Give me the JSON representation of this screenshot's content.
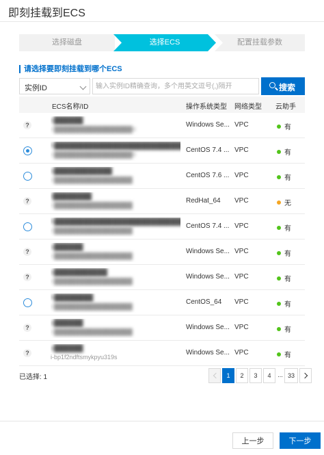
{
  "header": {
    "title": "即刻挂载到ECS"
  },
  "steps": [
    {
      "label": "选择磁盘",
      "state": "done"
    },
    {
      "label": "选择ECS",
      "state": "active"
    },
    {
      "label": "配置挂载参数",
      "state": "pending"
    }
  ],
  "section": {
    "label": "请选择要即刻挂载到哪个ECS"
  },
  "search": {
    "field_select_value": "实例ID",
    "placeholder": "输入实例ID精确查询，多个用英文逗号(,)隔开",
    "button_label": "搜索"
  },
  "table": {
    "columns": [
      "ECS名称/ID",
      "操作系统类型",
      "网络类型",
      "云助手"
    ],
    "rows": [
      {
        "select": "help",
        "name": "s██████",
        "id": "i-██████████████████4",
        "os": "Windows Se...",
        "net": "VPC",
        "assistant": "有",
        "assistant_status": "yes"
      },
      {
        "select": "radio-checked",
        "name": "h████████████████████████████",
        "id": "i-██████████████████9",
        "os": "CentOS 7.4 ...",
        "net": "VPC",
        "assistant": "有",
        "assistant_status": "yes"
      },
      {
        "select": "radio",
        "name": "s████████████",
        "id": "i-██████████████████",
        "os": "CentOS 7.6 ...",
        "net": "VPC",
        "assistant": "有",
        "assistant_status": "yes"
      },
      {
        "select": "help",
        "name": "r████████",
        "id": "i-██████████████████",
        "os": "RedHat_64",
        "net": "VPC",
        "assistant": "无",
        "assistant_status": "no"
      },
      {
        "select": "radio",
        "name": "h████████████████████████████",
        "id": "i-██████████████████",
        "os": "CentOS 7.4 ...",
        "net": "VPC",
        "assistant": "有",
        "assistant_status": "yes"
      },
      {
        "select": "help",
        "name": "s██████",
        "id": "i-██████████████████",
        "os": "Windows Se...",
        "net": "VPC",
        "assistant": "有",
        "assistant_status": "yes"
      },
      {
        "select": "help",
        "name": "s███████████",
        "id": "i-██████████████████",
        "os": "Windows Se...",
        "net": "VPC",
        "assistant": "有",
        "assistant_status": "yes"
      },
      {
        "select": "radio",
        "name": "h████████",
        "id": "i-██████████████████",
        "os": "CentOS_64",
        "net": "VPC",
        "assistant": "有",
        "assistant_status": "yes"
      },
      {
        "select": "help",
        "name": "s██████",
        "id": "i-██████████████████",
        "os": "Windows Se...",
        "net": "VPC",
        "assistant": "有",
        "assistant_status": "yes"
      },
      {
        "select": "help",
        "name": "s██████",
        "id": "i-bp1f2ndftsmykpyu319s",
        "id_visible": true,
        "os": "Windows Se...",
        "net": "VPC",
        "assistant": "有",
        "assistant_status": "yes"
      }
    ]
  },
  "footer_info": {
    "selected": "已选择: 1"
  },
  "pagination": {
    "pages": [
      "1",
      "2",
      "3",
      "4"
    ],
    "ellipsis": "...",
    "last_page": "33",
    "current": "1"
  },
  "buttons": {
    "prev": "上一步",
    "next": "下一步"
  },
  "colors": {
    "accent": "#0070cc",
    "step_active": "#00c1de",
    "status_yes": "#52c41a",
    "status_no": "#f5a623"
  }
}
